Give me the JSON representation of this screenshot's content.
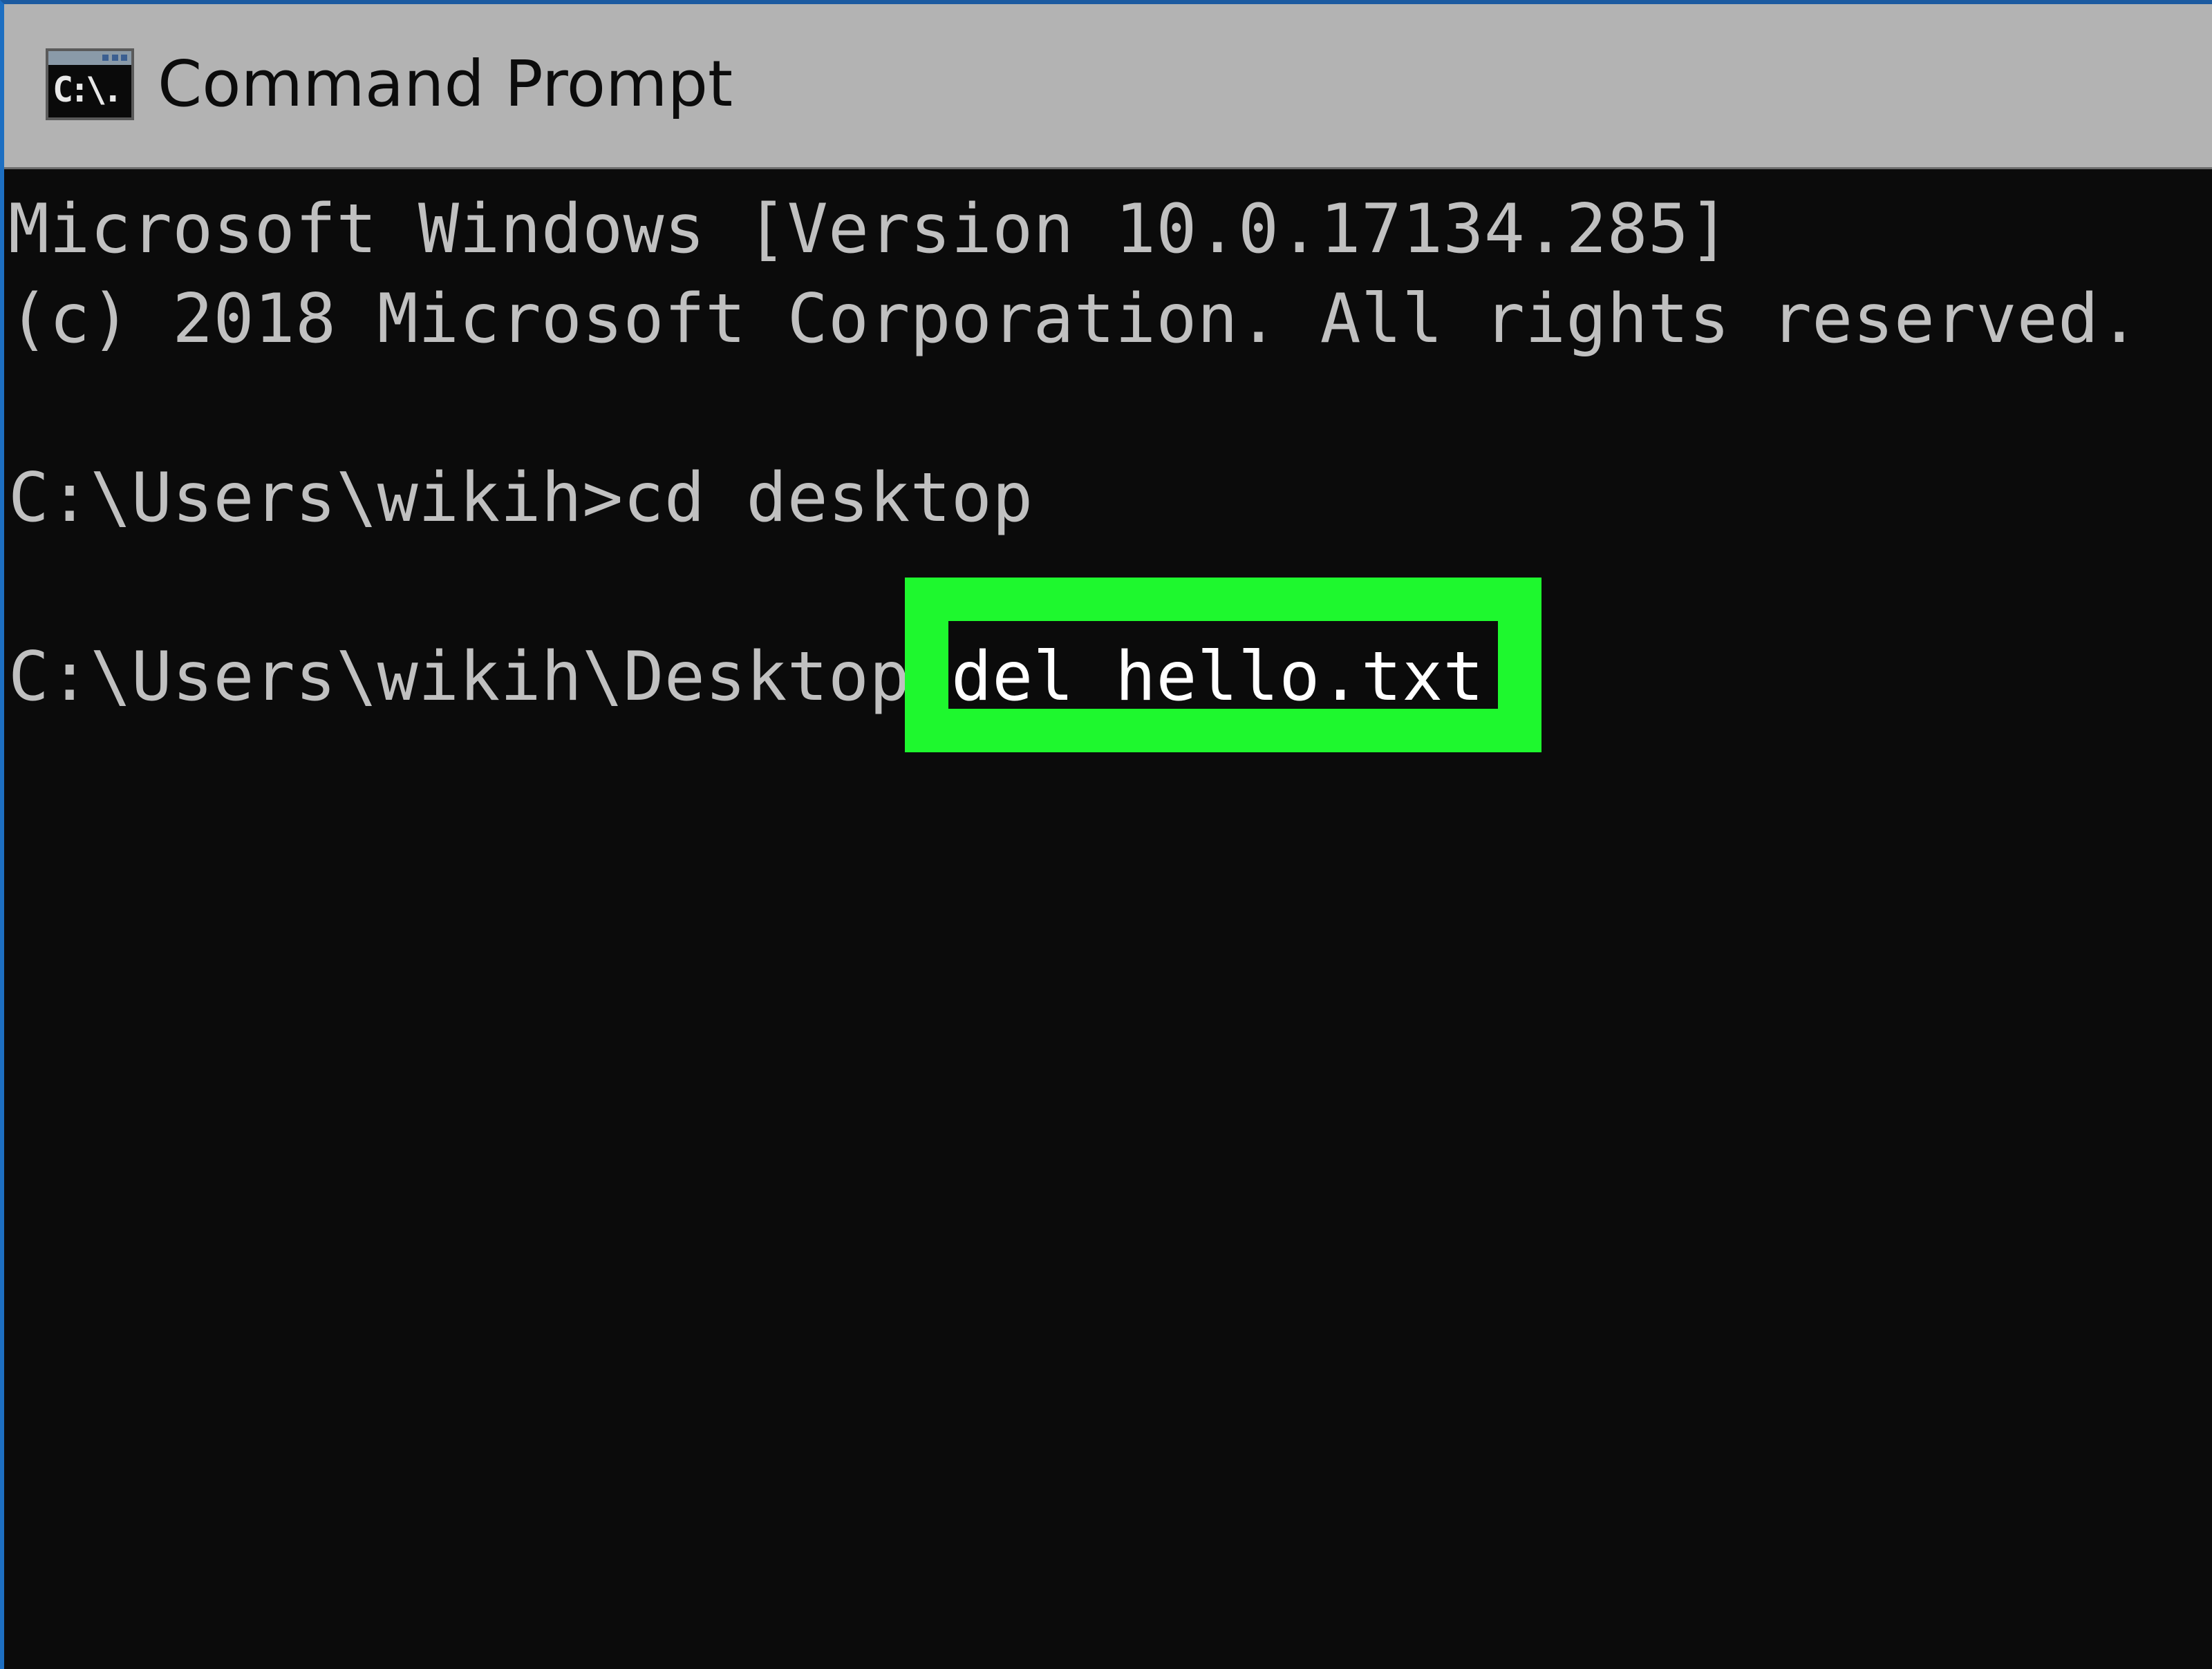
{
  "window": {
    "title": "Command Prompt",
    "icon": "cmd-app-icon",
    "icon_glyph": "C:\\.",
    "accent_border_color": "#1d6fc2",
    "titlebar_color": "#b3b3b3"
  },
  "console": {
    "text_color": "#c0c0c0",
    "background_color": "#0b0b0b",
    "lines": [
      {
        "text": "Microsoft Windows [Version 10.0.17134.285]"
      },
      {
        "text": "(c) 2018 Microsoft Corporation. All rights reserved."
      },
      {
        "text": ""
      },
      {
        "prompt": "C:\\Users\\wikih>",
        "command": "cd desktop"
      },
      {
        "text": ""
      },
      {
        "prompt": "C:\\Users\\wikih\\Desktop>",
        "command": "del hello.txt"
      }
    ]
  },
  "annotation": {
    "type": "highlight-box",
    "target_text": "del hello.txt",
    "color": "#1ef82e"
  }
}
